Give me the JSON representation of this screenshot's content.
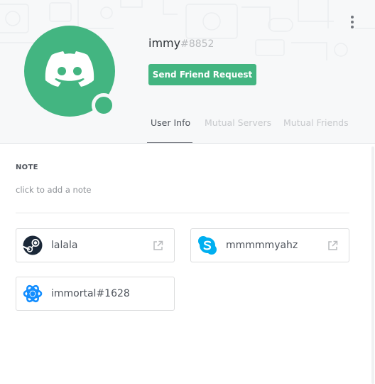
{
  "profile": {
    "username": "immy",
    "discriminator": "#8852",
    "avatar_icon": "discord-logo-icon",
    "status": "online",
    "friend_button_label": "Send Friend Request"
  },
  "tabs": [
    {
      "label": "User Info",
      "active": true
    },
    {
      "label": "Mutual Servers",
      "active": false
    },
    {
      "label": "Mutual Friends",
      "active": false
    }
  ],
  "note": {
    "label": "NOTE",
    "placeholder": "click to add a note"
  },
  "connected_accounts": [
    {
      "name": "lalala",
      "icon": "steam-icon",
      "external_link": true
    },
    {
      "name": "mmmmmyahz",
      "icon": "skype-icon",
      "external_link": true
    },
    {
      "name": "immortal#1628",
      "icon": "battlenet-icon",
      "external_link": false
    }
  ],
  "colors": {
    "brand_green": "#43b581",
    "skype_blue": "#00aff0",
    "battlenet_blue": "#148eff"
  }
}
